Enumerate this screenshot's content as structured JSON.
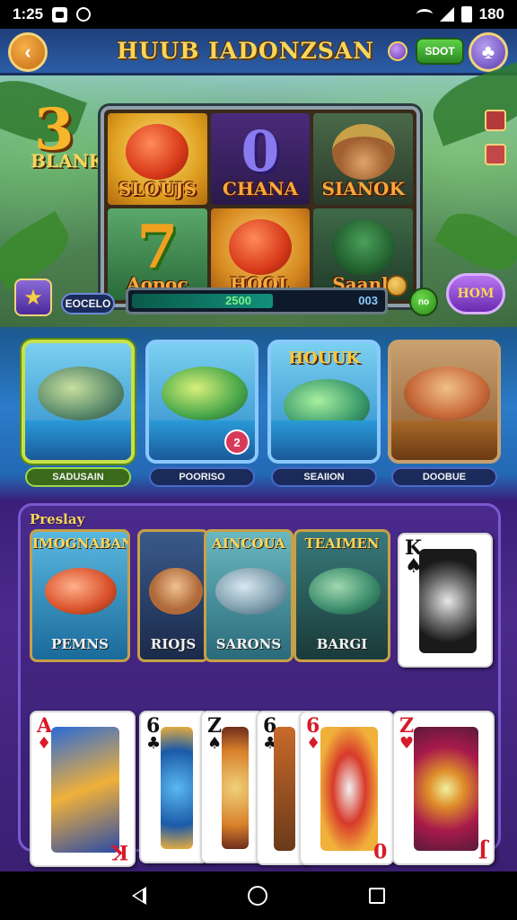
{
  "status_bar": {
    "time": "1:25",
    "right_text": "180"
  },
  "header": {
    "title": "HUUB IADONZSAN",
    "shot_label": "SDOT"
  },
  "scene": {
    "big_number": "3",
    "blank_label": "BLANK",
    "slots": [
      {
        "label": "SLOUJS"
      },
      {
        "label": "CHANA",
        "symbol": "0"
      },
      {
        "label": "SIANOK"
      },
      {
        "label": "Aopoc",
        "symbol": "7"
      },
      {
        "label": "HOOL"
      },
      {
        "label": "Saanb"
      }
    ],
    "pill_left": "EOCELO",
    "meter_value": "2500",
    "meter_right": "003",
    "meter_fill_fraction": 0.55,
    "green_btn": "no",
    "hom_label": "HOM"
  },
  "categories": [
    {
      "label": "SADUSAIN",
      "selected": true
    },
    {
      "label": "POORISO",
      "badge": "2"
    },
    {
      "label": "SEAIION",
      "title": "HOUUK"
    },
    {
      "label": "DOOBUE"
    }
  ],
  "panel": {
    "title": "Preslay",
    "tiles": [
      {
        "title": "IMOGNABAN",
        "label": "PEMNS"
      },
      {
        "title": "",
        "label": "RIOJS"
      },
      {
        "title": "AINCOUA",
        "label": "SARONS"
      },
      {
        "title": "TEAIMEN",
        "label": "BARGI"
      }
    ],
    "king_card": {
      "rank": "K",
      "suit": "♠"
    },
    "hand": [
      {
        "rank": "A",
        "rank_bottom": "K",
        "suit": "♦",
        "color": "red"
      },
      {
        "rank": "6",
        "suit": "♣",
        "color": "blk"
      },
      {
        "rank": "Z",
        "suit": "♠",
        "color": "blk"
      },
      {
        "rank": "6",
        "suit": "♣",
        "color": "blk"
      },
      {
        "rank": "6",
        "rank_bottom": "0",
        "suit": "♦",
        "color": "red"
      },
      {
        "rank": "Z",
        "rank_bottom": "J",
        "suit": "♥",
        "color": "red"
      }
    ]
  },
  "colors": {
    "accent_gold": "#f7d65a",
    "panel_purple": "#4a2a8c",
    "header_blue": "#2b5ea8"
  }
}
